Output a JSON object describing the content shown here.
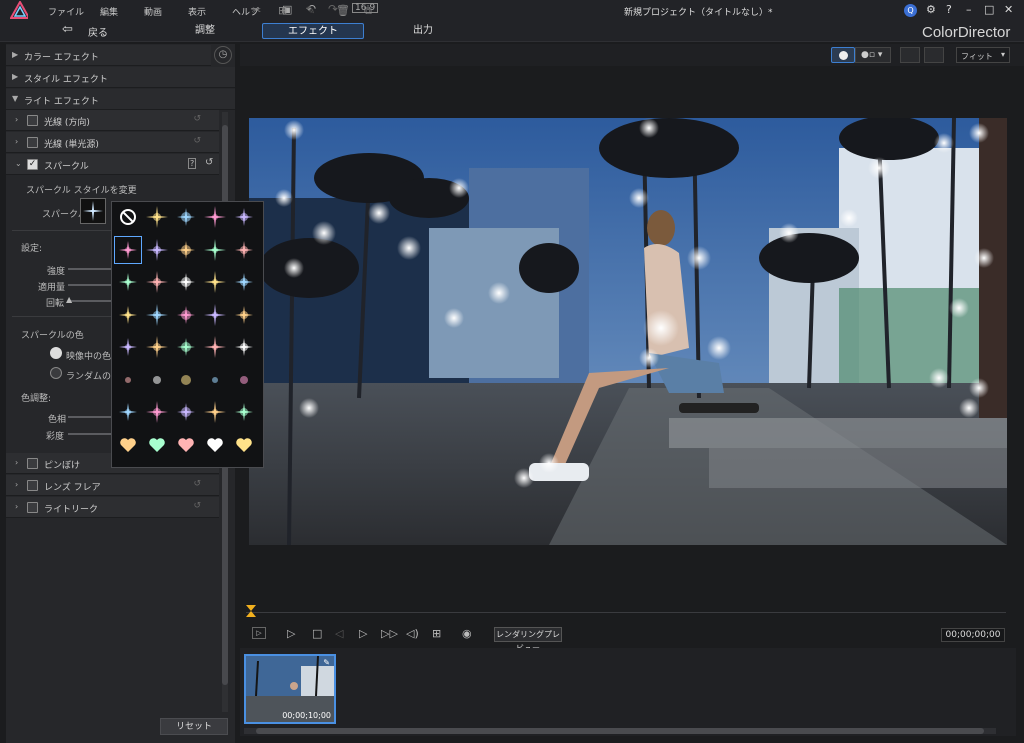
{
  "app": {
    "name": "ColorDirector",
    "window_title": "新規プロジェクト（タイトルなし）*"
  },
  "menu": [
    "ファイル",
    "編集",
    "動画",
    "表示",
    "ヘルプ"
  ],
  "nav": {
    "back": "戻る",
    "tabs": [
      "調整",
      "エフェクト",
      "出力"
    ],
    "active_tab": "エフェクト"
  },
  "left_panel": {
    "sections": {
      "color_effect": "カラー エフェクト",
      "style_effect": "スタイル エフェクト",
      "light_effect": "ライト エフェクト"
    },
    "light_items": {
      "ray_direction": "光線 (方向)",
      "ray_single": "光線 (単光源)",
      "sparkle": "スパークル",
      "bokeh": "ピンぼけ",
      "lens_flare": "レンズ フレア",
      "light_leak": "ライトリーク"
    },
    "sparkle": {
      "style_change_label": "スパークル スタイルを変更",
      "sparkle_label": "スパークル",
      "settings_label": "設定:",
      "intensity": "強度",
      "amount": "適用量",
      "rotation": "回転",
      "color_label": "スパークルの色",
      "color_option_1": "映像中の色を使用",
      "color_option_2": "ランダムの色を使用",
      "color_adjust_label": "色調整:",
      "hue": "色相",
      "saturation": "彩度"
    },
    "reset_label": "リセット"
  },
  "toolbar": {
    "fit_label": "フィット"
  },
  "playback": {
    "render_preview_label": "レンダリングプレビュー",
    "timecode": "00;00;00;00"
  },
  "filmstrip": {
    "clip_duration": "00;00;10;00"
  },
  "colors": {
    "accent": "#3d7fd1",
    "background": "#1b1c1e",
    "panel": "#26272a"
  }
}
